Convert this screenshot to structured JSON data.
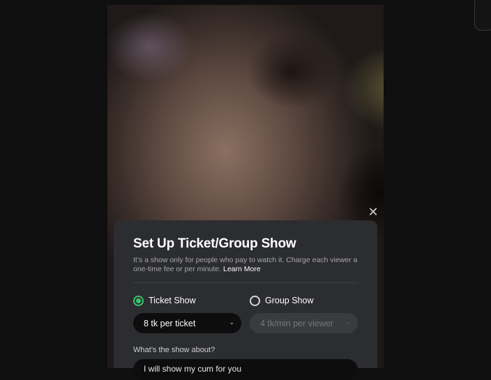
{
  "modal": {
    "title": "Set Up Ticket/Group Show",
    "description": "It’s a show only for people who pay to watch it. Charge each viewer a one-time fee or per minute.",
    "learn_more": "Learn More",
    "options": [
      {
        "label": "Ticket Show",
        "selected": true
      },
      {
        "label": "Group Show",
        "selected": false
      }
    ],
    "ticket_price": "8 tk per ticket",
    "group_price": "4 tk/min per viewer",
    "about_label": "What’s the show about?",
    "about_value": "I will show my cum for you"
  },
  "icons": {
    "close": "close-icon",
    "chevron": "chevron-down-icon"
  },
  "colors": {
    "accent": "#3cc46b",
    "modal_bg": "#2c2d30",
    "input_bg": "#0d0d0e"
  }
}
